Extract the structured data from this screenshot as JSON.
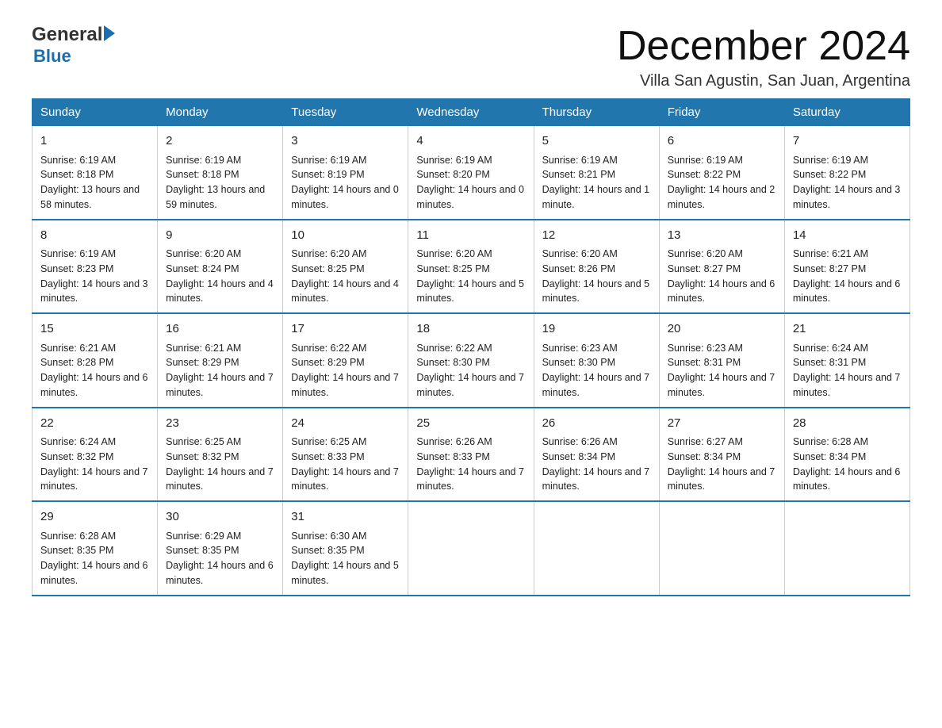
{
  "logo": {
    "general": "General",
    "blue": "Blue",
    "arrow": "▶"
  },
  "title": "December 2024",
  "location": "Villa San Agustin, San Juan, Argentina",
  "days_of_week": [
    "Sunday",
    "Monday",
    "Tuesday",
    "Wednesday",
    "Thursday",
    "Friday",
    "Saturday"
  ],
  "weeks": [
    [
      {
        "day": "1",
        "sunrise": "6:19 AM",
        "sunset": "8:18 PM",
        "daylight": "13 hours and 58 minutes."
      },
      {
        "day": "2",
        "sunrise": "6:19 AM",
        "sunset": "8:18 PM",
        "daylight": "13 hours and 59 minutes."
      },
      {
        "day": "3",
        "sunrise": "6:19 AM",
        "sunset": "8:19 PM",
        "daylight": "14 hours and 0 minutes."
      },
      {
        "day": "4",
        "sunrise": "6:19 AM",
        "sunset": "8:20 PM",
        "daylight": "14 hours and 0 minutes."
      },
      {
        "day": "5",
        "sunrise": "6:19 AM",
        "sunset": "8:21 PM",
        "daylight": "14 hours and 1 minute."
      },
      {
        "day": "6",
        "sunrise": "6:19 AM",
        "sunset": "8:22 PM",
        "daylight": "14 hours and 2 minutes."
      },
      {
        "day": "7",
        "sunrise": "6:19 AM",
        "sunset": "8:22 PM",
        "daylight": "14 hours and 3 minutes."
      }
    ],
    [
      {
        "day": "8",
        "sunrise": "6:19 AM",
        "sunset": "8:23 PM",
        "daylight": "14 hours and 3 minutes."
      },
      {
        "day": "9",
        "sunrise": "6:20 AM",
        "sunset": "8:24 PM",
        "daylight": "14 hours and 4 minutes."
      },
      {
        "day": "10",
        "sunrise": "6:20 AM",
        "sunset": "8:25 PM",
        "daylight": "14 hours and 4 minutes."
      },
      {
        "day": "11",
        "sunrise": "6:20 AM",
        "sunset": "8:25 PM",
        "daylight": "14 hours and 5 minutes."
      },
      {
        "day": "12",
        "sunrise": "6:20 AM",
        "sunset": "8:26 PM",
        "daylight": "14 hours and 5 minutes."
      },
      {
        "day": "13",
        "sunrise": "6:20 AM",
        "sunset": "8:27 PM",
        "daylight": "14 hours and 6 minutes."
      },
      {
        "day": "14",
        "sunrise": "6:21 AM",
        "sunset": "8:27 PM",
        "daylight": "14 hours and 6 minutes."
      }
    ],
    [
      {
        "day": "15",
        "sunrise": "6:21 AM",
        "sunset": "8:28 PM",
        "daylight": "14 hours and 6 minutes."
      },
      {
        "day": "16",
        "sunrise": "6:21 AM",
        "sunset": "8:29 PM",
        "daylight": "14 hours and 7 minutes."
      },
      {
        "day": "17",
        "sunrise": "6:22 AM",
        "sunset": "8:29 PM",
        "daylight": "14 hours and 7 minutes."
      },
      {
        "day": "18",
        "sunrise": "6:22 AM",
        "sunset": "8:30 PM",
        "daylight": "14 hours and 7 minutes."
      },
      {
        "day": "19",
        "sunrise": "6:23 AM",
        "sunset": "8:30 PM",
        "daylight": "14 hours and 7 minutes."
      },
      {
        "day": "20",
        "sunrise": "6:23 AM",
        "sunset": "8:31 PM",
        "daylight": "14 hours and 7 minutes."
      },
      {
        "day": "21",
        "sunrise": "6:24 AM",
        "sunset": "8:31 PM",
        "daylight": "14 hours and 7 minutes."
      }
    ],
    [
      {
        "day": "22",
        "sunrise": "6:24 AM",
        "sunset": "8:32 PM",
        "daylight": "14 hours and 7 minutes."
      },
      {
        "day": "23",
        "sunrise": "6:25 AM",
        "sunset": "8:32 PM",
        "daylight": "14 hours and 7 minutes."
      },
      {
        "day": "24",
        "sunrise": "6:25 AM",
        "sunset": "8:33 PM",
        "daylight": "14 hours and 7 minutes."
      },
      {
        "day": "25",
        "sunrise": "6:26 AM",
        "sunset": "8:33 PM",
        "daylight": "14 hours and 7 minutes."
      },
      {
        "day": "26",
        "sunrise": "6:26 AM",
        "sunset": "8:34 PM",
        "daylight": "14 hours and 7 minutes."
      },
      {
        "day": "27",
        "sunrise": "6:27 AM",
        "sunset": "8:34 PM",
        "daylight": "14 hours and 7 minutes."
      },
      {
        "day": "28",
        "sunrise": "6:28 AM",
        "sunset": "8:34 PM",
        "daylight": "14 hours and 6 minutes."
      }
    ],
    [
      {
        "day": "29",
        "sunrise": "6:28 AM",
        "sunset": "8:35 PM",
        "daylight": "14 hours and 6 minutes."
      },
      {
        "day": "30",
        "sunrise": "6:29 AM",
        "sunset": "8:35 PM",
        "daylight": "14 hours and 6 minutes."
      },
      {
        "day": "31",
        "sunrise": "6:30 AM",
        "sunset": "8:35 PM",
        "daylight": "14 hours and 5 minutes."
      },
      null,
      null,
      null,
      null
    ]
  ],
  "labels": {
    "sunrise": "Sunrise:",
    "sunset": "Sunset:",
    "daylight": "Daylight:"
  }
}
